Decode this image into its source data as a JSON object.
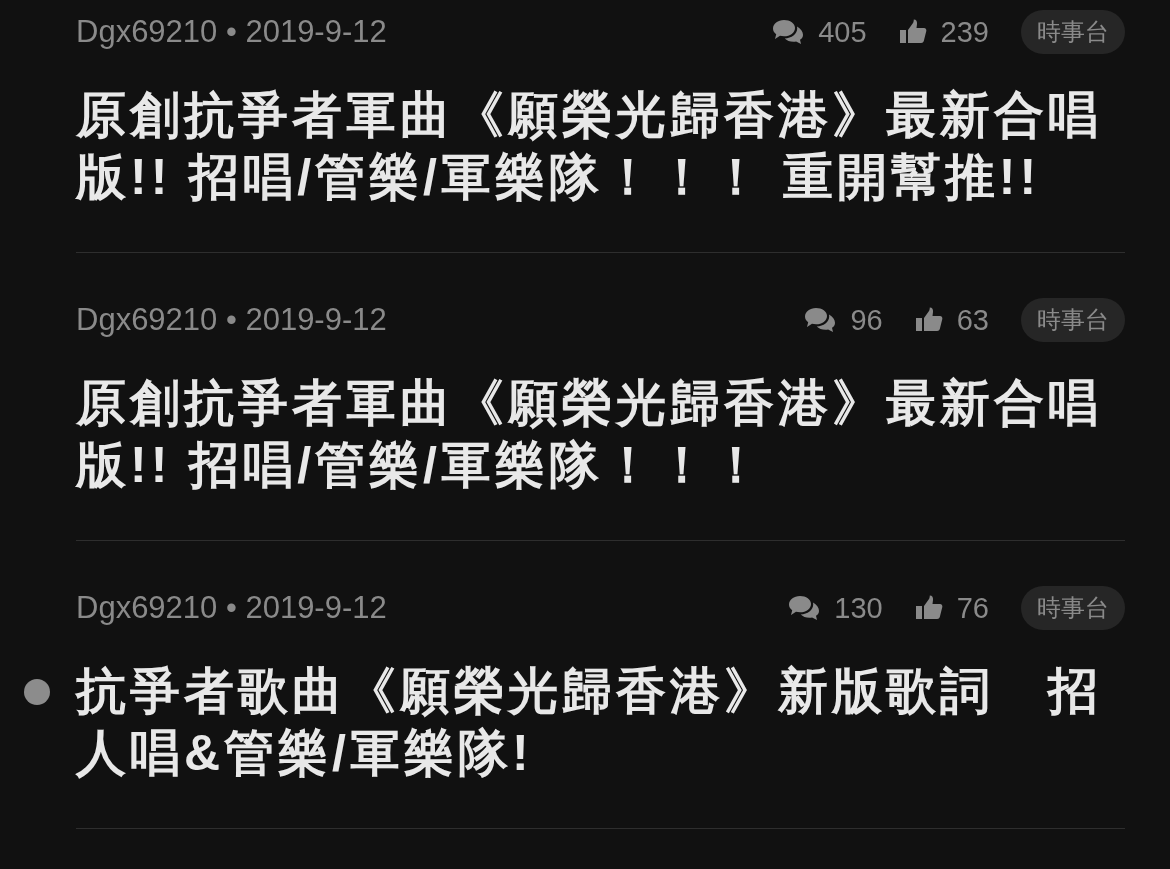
{
  "threads": [
    {
      "author": "Dgx69210",
      "separator": "•",
      "date": "2019-9-12",
      "comments": "405",
      "likes": "239",
      "tag": "時事台",
      "title": "原創抗爭者軍曲《願榮光歸香港》最新合唱版!! 招唱/管樂/軍樂隊！！！ 重開幫推!!",
      "marked": false
    },
    {
      "author": "Dgx69210",
      "separator": "•",
      "date": "2019-9-12",
      "comments": "96",
      "likes": "63",
      "tag": "時事台",
      "title": "原創抗爭者軍曲《願榮光歸香港》最新合唱版!! 招唱/管樂/軍樂隊！！！",
      "marked": false
    },
    {
      "author": "Dgx69210",
      "separator": "•",
      "date": "2019-9-12",
      "comments": "130",
      "likes": "76",
      "tag": "時事台",
      "title": "抗爭者歌曲《願榮光歸香港》新版歌詞　招人唱&管樂/軍樂隊!",
      "marked": true
    }
  ]
}
